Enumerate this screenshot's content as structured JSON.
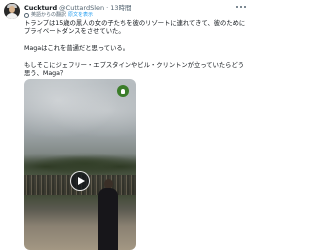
{
  "post": {
    "author": {
      "name": "Cuckturd",
      "handle": "@CuttardSlen",
      "separator": "·",
      "time": "13時間"
    },
    "translation": {
      "note": "英語からの翻訳",
      "link_label": "原文を表示"
    },
    "text": {
      "line1": "トランプは15歳の黒人の女の子たちを彼のリゾートに連れてきて、彼のためにプライベートダンスをさせていた。",
      "line2": "Magaはこれを普通だと思っている。",
      "line3": "もしそこにジェフリー・エプスタインやビル・クリントンが立っていたらどう思う、Maga？"
    },
    "icons": {
      "avatar": "avatar",
      "more": "more-icon",
      "globe": "globe-icon",
      "play": "play-icon",
      "badge": "media-badge-icon"
    },
    "colors": {
      "text": "#0f1419",
      "muted": "#536471",
      "link": "#1d9bf0"
    }
  }
}
